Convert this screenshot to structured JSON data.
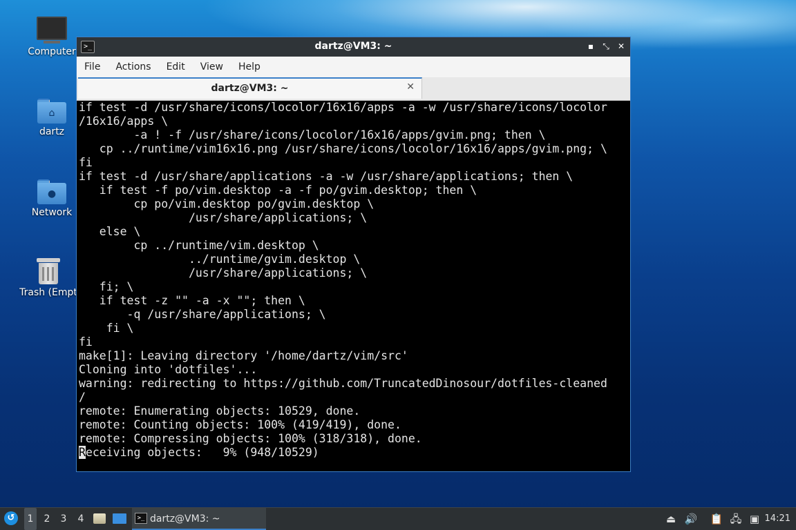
{
  "desktop": {
    "icons": [
      {
        "label": "Computer"
      },
      {
        "label": "dartz"
      },
      {
        "label": "Network"
      },
      {
        "label": "Trash (Empt"
      }
    ]
  },
  "window": {
    "title": "dartz@VM3: ~",
    "icon": "terminal-icon",
    "controls": {
      "minimize": "▪",
      "maximize": "⤡",
      "close": "✕"
    },
    "menu": [
      "File",
      "Actions",
      "Edit",
      "View",
      "Help"
    ],
    "tab": {
      "title": "dartz@VM3: ~",
      "close": "✕"
    },
    "terminal_lines": [
      "if test -d /usr/share/icons/locolor/16x16/apps -a -w /usr/share/icons/locolor",
      "/16x16/apps \\",
      "        -a ! -f /usr/share/icons/locolor/16x16/apps/gvim.png; then \\",
      "   cp ../runtime/vim16x16.png /usr/share/icons/locolor/16x16/apps/gvim.png; \\",
      "fi",
      "if test -d /usr/share/applications -a -w /usr/share/applications; then \\",
      "   if test -f po/vim.desktop -a -f po/gvim.desktop; then \\",
      "        cp po/vim.desktop po/gvim.desktop \\",
      "                /usr/share/applications; \\",
      "   else \\",
      "        cp ../runtime/vim.desktop \\",
      "                ../runtime/gvim.desktop \\",
      "                /usr/share/applications; \\",
      "   fi; \\",
      "   if test -z \"\" -a -x \"\"; then \\",
      "       -q /usr/share/applications; \\",
      "    fi \\",
      "fi",
      "make[1]: Leaving directory '/home/dartz/vim/src'",
      "Cloning into 'dotfiles'...",
      "warning: redirecting to https://github.com/TruncatedDinosour/dotfiles-cleaned",
      "/",
      "remote: Enumerating objects: 10529, done.",
      "remote: Counting objects: 100% (419/419), done.",
      "remote: Compressing objects: 100% (318/318), done."
    ],
    "last_line_cursor_char": "R",
    "last_line_rest": "eceiving objects:   9% (948/10529)"
  },
  "panel": {
    "workspaces": [
      "1",
      "2",
      "3",
      "4"
    ],
    "active_workspace": "1",
    "task_label": "dartz@VM3: ~",
    "tray": [
      "eject-icon",
      "volume-icon",
      "clipboard-icon",
      "network-icon",
      "notification-icon"
    ],
    "clock": "14:21"
  }
}
